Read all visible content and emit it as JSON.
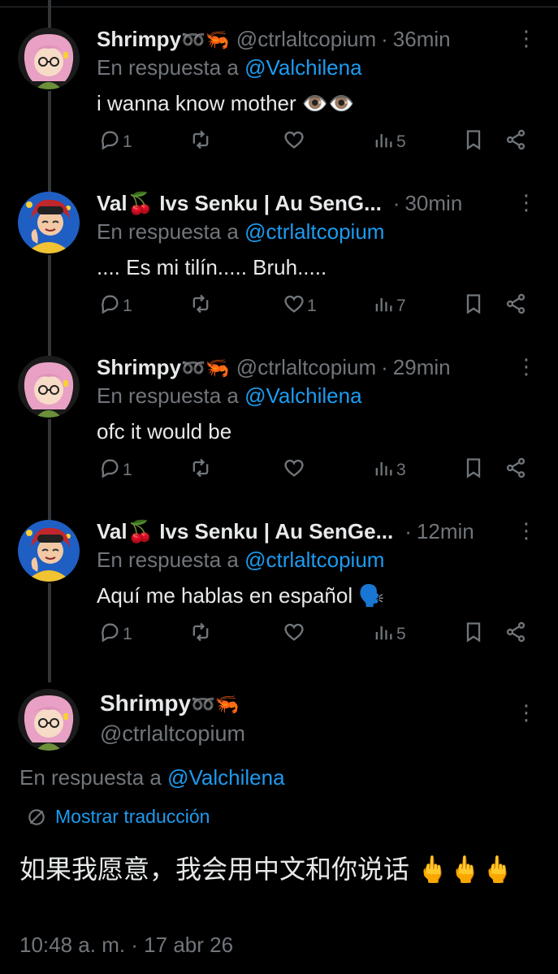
{
  "replies": [
    {
      "name": "Shrimpy",
      "name_emoji": "➿🦐",
      "handle": "@ctrlaltcopium",
      "separator": "·",
      "time": "36min",
      "reply_prefix": "En respuesta a",
      "reply_to": "@Valchilena",
      "text": "i wanna know mother 👁️👁️",
      "replies_count": "1",
      "retweets_count": "",
      "likes_count": "",
      "views_count": "5",
      "avatar": "shrimpy"
    },
    {
      "name": "Val🍒 Ivs Senku | Au SenG...",
      "name_emoji": "",
      "handle": "",
      "separator": "·",
      "time": "30min",
      "reply_prefix": "En respuesta a",
      "reply_to": "@ctrlaltcopium",
      "text": ".... Es mi tilín..... Bruh.....",
      "replies_count": "1",
      "retweets_count": "",
      "likes_count": "1",
      "views_count": "7",
      "avatar": "val"
    },
    {
      "name": "Shrimpy",
      "name_emoji": "➿🦐",
      "handle": "@ctrlaltcopium",
      "separator": "·",
      "time": "29min",
      "reply_prefix": "En respuesta a",
      "reply_to": "@Valchilena",
      "text": "ofc it would be",
      "replies_count": "1",
      "retweets_count": "",
      "likes_count": "",
      "views_count": "3",
      "avatar": "shrimpy"
    },
    {
      "name": "Val🍒 Ivs Senku | Au SenGe...",
      "name_emoji": "",
      "handle": "",
      "separator": "·",
      "time": "12min",
      "reply_prefix": "En respuesta a",
      "reply_to": "@ctrlaltcopium",
      "text": "Aquí me hablas en español 🗣️",
      "replies_count": "1",
      "retweets_count": "",
      "likes_count": "",
      "views_count": "5",
      "avatar": "val"
    }
  ],
  "main_tweet": {
    "name": "Shrimpy",
    "name_emoji": "➿🦐",
    "handle": "@ctrlaltcopium",
    "reply_prefix": "En respuesta a",
    "reply_to": "@Valchilena",
    "translate_label": "Mostrar traducción",
    "text": "如果我愿意，我会用中文和你说话 🖕🖕🖕",
    "timestamp": "10:48 a. m. · 17 abr 26"
  },
  "icons": {
    "more": "more-vertical-icon",
    "reply": "comment-icon",
    "retweet": "retweet-icon",
    "like": "heart-icon",
    "views": "bar-chart-icon",
    "bookmark": "bookmark-icon",
    "share": "share-icon",
    "translate": "translate-icon"
  },
  "colors": {
    "background": "#000000",
    "text": "#e7e9ea",
    "muted": "#71767b",
    "link": "#1d9bf0",
    "thread_line": "#333639"
  }
}
